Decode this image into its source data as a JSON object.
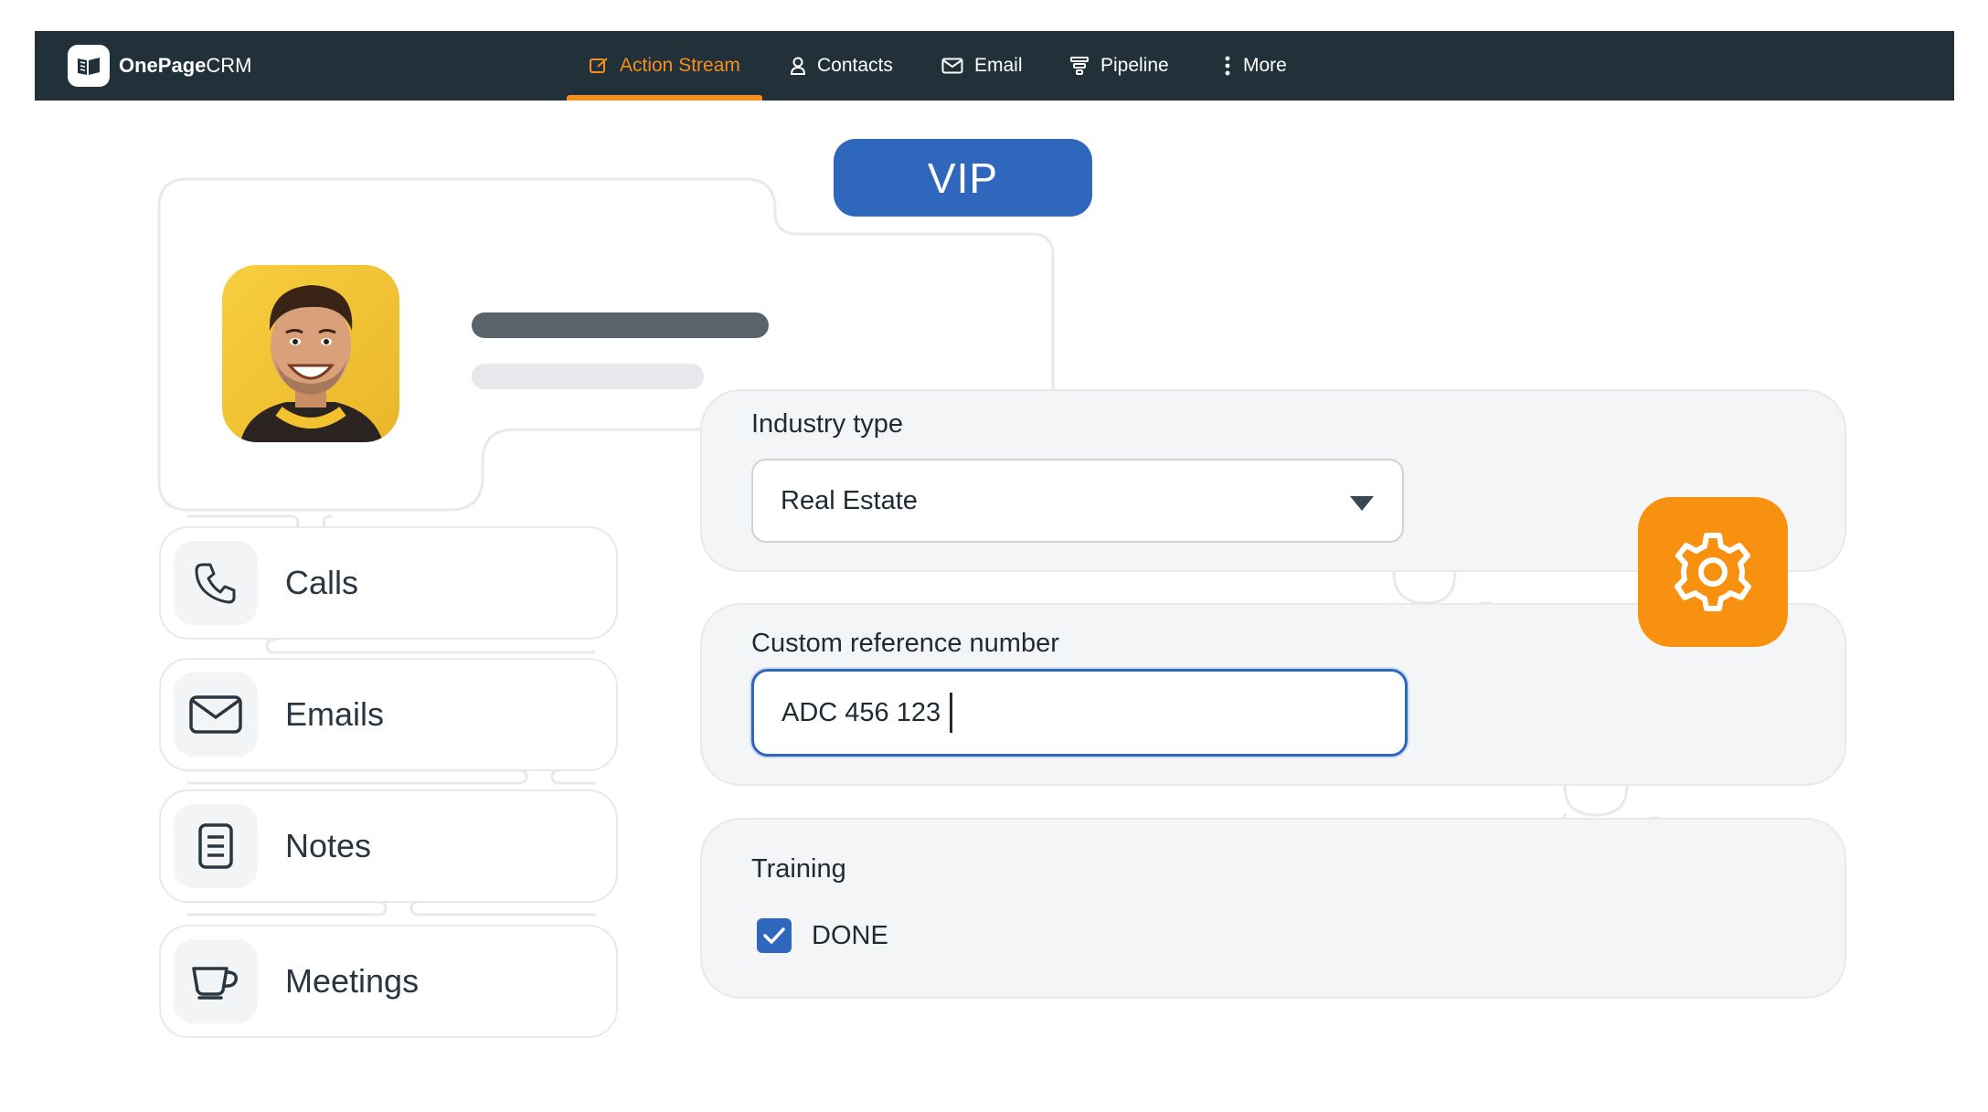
{
  "app": {
    "brand_bold": "OnePage",
    "brand_light": "CRM"
  },
  "nav": {
    "items": [
      {
        "label": "Action Stream",
        "icon": "action-stream-icon",
        "active": true
      },
      {
        "label": "Contacts",
        "icon": "contacts-icon",
        "active": false
      },
      {
        "label": "Email",
        "icon": "email-icon",
        "active": false
      },
      {
        "label": "Pipeline",
        "icon": "pipeline-icon",
        "active": false
      },
      {
        "label": "More",
        "icon": "more-icon",
        "active": false
      }
    ]
  },
  "contact": {
    "badge": "VIP",
    "avatar": "avatar-photo"
  },
  "activities": [
    {
      "label": "Calls",
      "icon": "phone-icon"
    },
    {
      "label": "Emails",
      "icon": "envelope-icon"
    },
    {
      "label": "Notes",
      "icon": "note-icon"
    },
    {
      "label": "Meetings",
      "icon": "cup-icon"
    }
  ],
  "form": {
    "industry": {
      "label": "Industry type",
      "value": "Real Estate"
    },
    "reference": {
      "label": "Custom reference number",
      "value": "ADC 456 123"
    },
    "training": {
      "label": "Training",
      "checkbox_label": "DONE",
      "checked": true
    }
  },
  "colors": {
    "nav_bg": "#213039",
    "accent_orange": "#f5901e",
    "vip_blue": "#2f67bd",
    "panel_bg": "#f4f5f7"
  }
}
